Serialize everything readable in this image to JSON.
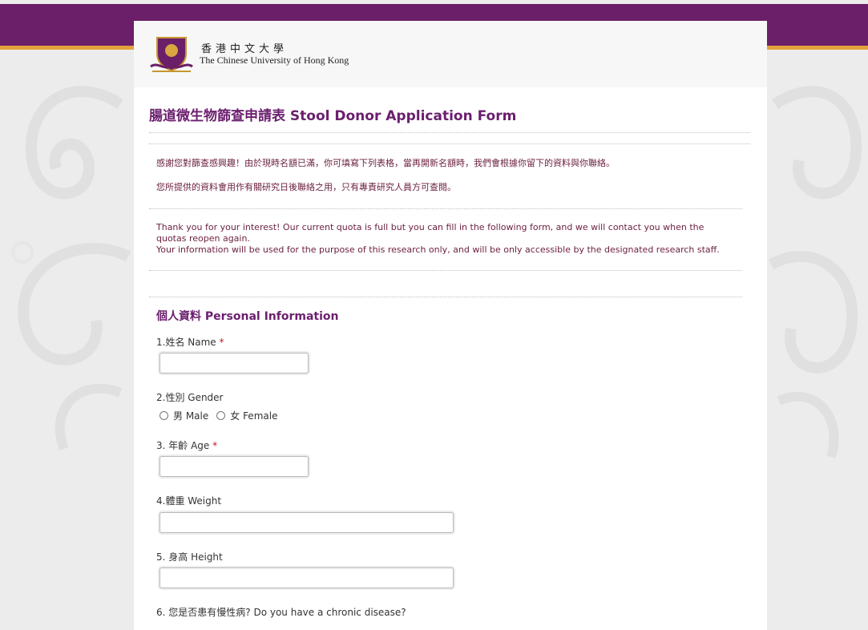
{
  "header": {
    "logo_chinese": "香港中文大學",
    "logo_english": "The Chinese University of Hong Kong"
  },
  "form": {
    "title": "腸道微生物篩查申請表 Stool Donor Application Form",
    "intro_zh_1": "感謝您對篩查感興趣！由於現時名額已滿，你可填寫下列表格，當再開新名額時，我們會根據你留下的資料與你聯絡。",
    "intro_zh_2": "您所提供的資料會用作有關研究日後聯絡之用，只有專責研究人員方可查閱。",
    "intro_en_1": "Thank you for your interest! Our current quota is full but you can fill in the following form, and we will contact you when the quotas reopen again.",
    "intro_en_2": "Your information will be used for the purpose of this research only, and will be only accessible by the designated research staff.",
    "section_title": "個人資料 Personal Information",
    "questions": {
      "name": {
        "label": "1.姓名 Name",
        "required": "*",
        "value": ""
      },
      "gender": {
        "label": "2.性別 Gender",
        "options": [
          "男 Male",
          "女 Female"
        ]
      },
      "age": {
        "label": "3. 年齡 Age",
        "required": "*",
        "value": ""
      },
      "weight": {
        "label": "4.體重 Weight",
        "value": ""
      },
      "height": {
        "label": "5. 身高 Height",
        "value": ""
      },
      "chronic": {
        "label": "6. 您是否患有慢性病? Do you have a chronic disease?"
      }
    }
  },
  "colors": {
    "header_purple": "#6a1f68",
    "accent_gold": "#e2a23a",
    "title_purple": "#6b1f6e",
    "required_red": "#c0181d"
  }
}
